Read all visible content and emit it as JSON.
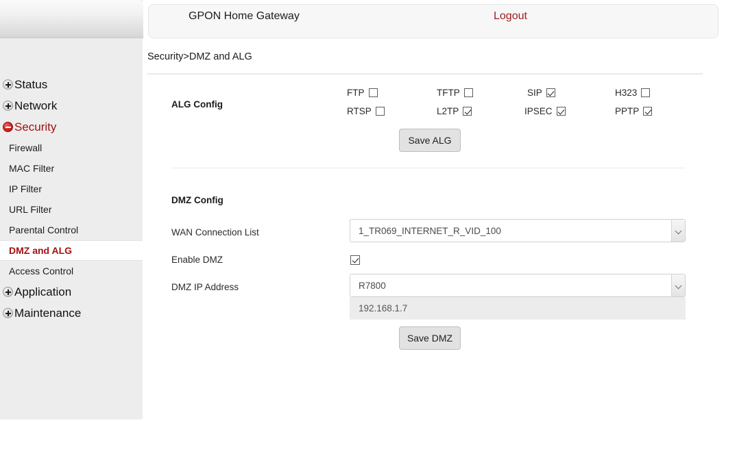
{
  "header": {
    "app_title": "GPON Home Gateway",
    "logout_label": "Logout"
  },
  "breadcrumb": "Security>DMZ and ALG",
  "sidebar": {
    "top_items": [
      {
        "label": "Status",
        "icon": "plus-icon",
        "state": "collapsed"
      },
      {
        "label": "Network",
        "icon": "plus-icon",
        "state": "collapsed"
      },
      {
        "label": "Security",
        "icon": "minus-icon",
        "state": "expanded"
      }
    ],
    "security_subitems": [
      {
        "label": "Firewall",
        "selected": false
      },
      {
        "label": "MAC Filter",
        "selected": false
      },
      {
        "label": "IP Filter",
        "selected": false
      },
      {
        "label": "URL Filter",
        "selected": false
      },
      {
        "label": "Parental Control",
        "selected": false
      },
      {
        "label": "DMZ and ALG",
        "selected": true
      },
      {
        "label": "Access Control",
        "selected": false
      }
    ],
    "bottom_items": [
      {
        "label": "Application",
        "icon": "plus-icon",
        "state": "collapsed"
      },
      {
        "label": "Maintenance",
        "icon": "plus-icon",
        "state": "collapsed"
      }
    ]
  },
  "alg_config": {
    "section_label": "ALG Config",
    "checkboxes": [
      {
        "label": "FTP",
        "checked": false
      },
      {
        "label": "TFTP",
        "checked": false
      },
      {
        "label": "SIP",
        "checked": true
      },
      {
        "label": "H323",
        "checked": false
      },
      {
        "label": "RTSP",
        "checked": false
      },
      {
        "label": "L2TP",
        "checked": true
      },
      {
        "label": "IPSEC",
        "checked": true
      },
      {
        "label": "PPTP",
        "checked": true
      }
    ],
    "save_button": "Save ALG"
  },
  "dmz_config": {
    "section_label": "DMZ Config",
    "wan_connection_label": "WAN Connection List",
    "wan_connection_value": "1_TR069_INTERNET_R_VID_100",
    "enable_dmz_label": "Enable DMZ",
    "enable_dmz_checked": true,
    "dmz_ip_label": "DMZ IP Address",
    "dmz_ip_value": "R7800",
    "dmz_ip_resolved": "192.168.1.7",
    "save_button": "Save DMZ"
  },
  "colors": {
    "accent_red": "#a51010",
    "logout_red": "#9e1b1b",
    "sidebar_bg": "#ededed",
    "panel_bg": "#f7f7f7"
  }
}
